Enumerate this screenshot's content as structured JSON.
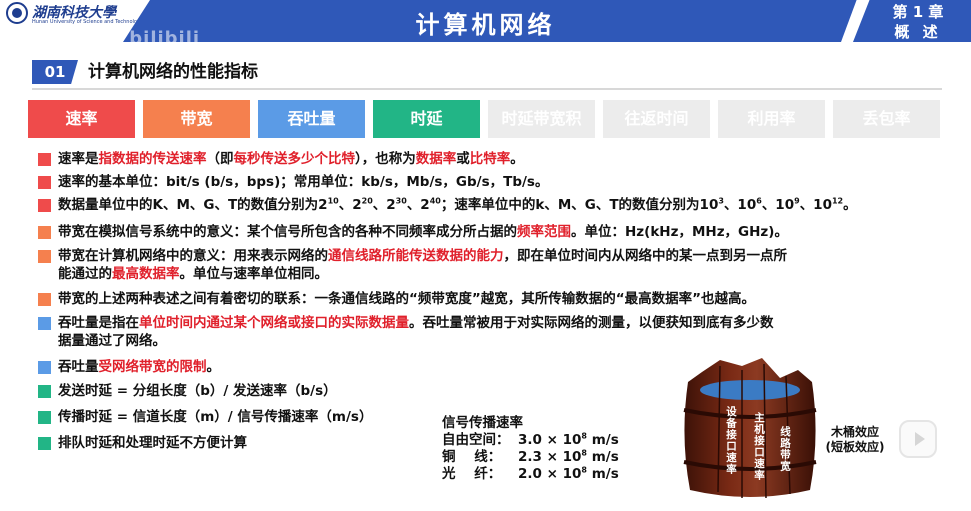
{
  "header": {
    "logo_text": "湖南科技大學",
    "logo_sub": "Hunan University of Science and Technology",
    "watermark": "湖科大教书匠 bilibili",
    "title": "计算机网络",
    "chapter": "第 1 章",
    "chapter_name": "概 述"
  },
  "section": {
    "number": "01",
    "title": "计算机网络的性能指标"
  },
  "tabs": [
    {
      "label": "速率",
      "color": "#ef4b4b"
    },
    {
      "label": "带宽",
      "color": "#f5804e"
    },
    {
      "label": "吞吐量",
      "color": "#5b9be6"
    },
    {
      "label": "时延",
      "color": "#22b586"
    },
    {
      "label": "时延带宽积",
      "color": "#ececec"
    },
    {
      "label": "往返时间",
      "color": "#ececec"
    },
    {
      "label": "利用率",
      "color": "#ececec"
    },
    {
      "label": "丢包率",
      "color": "#ececec"
    }
  ],
  "items": [
    {
      "color": "#ef4b4b",
      "parts": [
        [
          "速率是",
          ""
        ],
        [
          "指数据的传送速率",
          "red"
        ],
        [
          "（即",
          ""
        ],
        [
          "每秒传送多少个比特",
          "red"
        ],
        [
          "），也称为",
          ""
        ],
        [
          "数据率",
          "red"
        ],
        [
          "或",
          ""
        ],
        [
          "比特率",
          "red"
        ],
        [
          "。",
          ""
        ]
      ]
    },
    {
      "color": "#ef4b4b",
      "parts": [
        [
          "速率的基本单位：bit/s (b/s，bps)；常用单位：kb/s，Mb/s，Gb/s，Tb/s。",
          ""
        ]
      ]
    },
    {
      "color": "#ef4b4b",
      "parts": [
        [
          "数据量单位中的K、M、G、T的数值分别为2",
          ""
        ],
        [
          "10",
          "sup"
        ],
        [
          "、2",
          ""
        ],
        [
          "20",
          "sup"
        ],
        [
          "、2",
          ""
        ],
        [
          "30",
          "sup"
        ],
        [
          "、2",
          ""
        ],
        [
          "40",
          "sup"
        ],
        [
          "；速率单位中的k、M、G、T的数值分别为10",
          ""
        ],
        [
          "3",
          "sup"
        ],
        [
          "、10",
          ""
        ],
        [
          "6",
          "sup"
        ],
        [
          "、10",
          ""
        ],
        [
          "9",
          "sup"
        ],
        [
          "、10",
          ""
        ],
        [
          "12",
          "sup"
        ],
        [
          "。",
          ""
        ]
      ]
    },
    {
      "color": "#f5804e",
      "parts": [
        [
          "带宽在模拟信号系统中的意义：某个信号所包含的各种不同频率成分所占据的",
          ""
        ],
        [
          "频率范围",
          "red"
        ],
        [
          "。单位：Hz(kHz，MHz，GHz)。",
          ""
        ]
      ]
    },
    {
      "color": "#f5804e",
      "parts": [
        [
          "带宽在计算机网络中的意义：用来表示网络的",
          ""
        ],
        [
          "通信线路所能传送数据的能力",
          "red"
        ],
        [
          "，即在单位时间内从网络中的某一点到另一点所",
          ""
        ]
      ],
      "line2": [
        [
          "能通过的",
          ""
        ],
        [
          "最高数据率",
          "red"
        ],
        [
          "。单位与速率单位相同。",
          ""
        ]
      ]
    },
    {
      "color": "#f5804e",
      "parts": [
        [
          "带宽的上述两种表述之间有着密切的联系：一条通信线路的“频带宽度”越宽，其所传输数据的“最高数据率”也越高。",
          ""
        ]
      ]
    },
    {
      "color": "#5b9be6",
      "parts": [
        [
          "吞吐量是指在",
          ""
        ],
        [
          "单位时间内通过某个网络或接口的实际数据量",
          "red"
        ],
        [
          "。吞吐量常被用于对实际网络的测量，以便获知到底有多少数",
          ""
        ]
      ],
      "line2": [
        [
          "据量通过了网络。",
          ""
        ]
      ]
    },
    {
      "color": "#5b9be6",
      "parts": [
        [
          "吞吐量",
          ""
        ],
        [
          "受网络带宽的限制",
          "red"
        ],
        [
          "。",
          ""
        ]
      ]
    },
    {
      "color": "#22b586",
      "parts": [
        [
          "发送时延 = 分组长度（b）/ 发送速率（b/s）",
          ""
        ]
      ]
    },
    {
      "color": "#22b586",
      "parts": [
        [
          "传播时延 = 信道长度（m）/ 信号传播速率（m/s）",
          ""
        ]
      ]
    },
    {
      "color": "#22b586",
      "parts": [
        [
          "排队时延和处理时延不方便计算",
          ""
        ]
      ]
    }
  ],
  "signal": {
    "title": "信号传播速率",
    "rows": [
      {
        "label": "自由空间：",
        "value": "3.0 × 10",
        "exp": "8",
        "unit": " m/s"
      },
      {
        "label": "铜    线：",
        "value": "2.3 × 10",
        "exp": "8",
        "unit": " m/s"
      },
      {
        "label": "光    纤：",
        "value": "2.0 × 10",
        "exp": "8",
        "unit": " m/s"
      }
    ]
  },
  "barrel": {
    "staves": [
      "设备接口速率",
      "主机接口速率",
      "线路带宽"
    ],
    "label_line1": "木桶效应",
    "label_line2": "(短板效应)"
  }
}
